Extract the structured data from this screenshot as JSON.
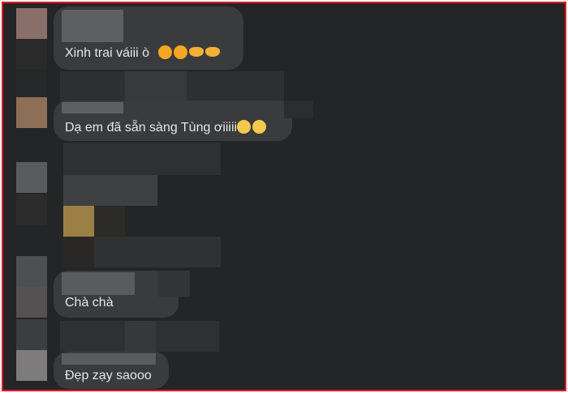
{
  "comments": [
    {
      "text": "Xinh trai váiii ò",
      "emojis": [
        "kiss-emoji",
        "kiss-emoji",
        "heart-hands-emoji",
        "heart-hands-emoji"
      ]
    },
    {
      "text": "Dạ em đã sẵn sàng Tùng ơiiiii",
      "emojis": [
        "flushed-emoji",
        "flushed-emoji"
      ]
    },
    {
      "text": "Chà chà",
      "emojis": []
    },
    {
      "text": "Đẹp zạy saooo",
      "emojis": []
    }
  ],
  "colors": {
    "frame_border": "#e21b23",
    "background": "#242526",
    "bubble": "#3a3b3c",
    "text": "#e4e6eb"
  }
}
